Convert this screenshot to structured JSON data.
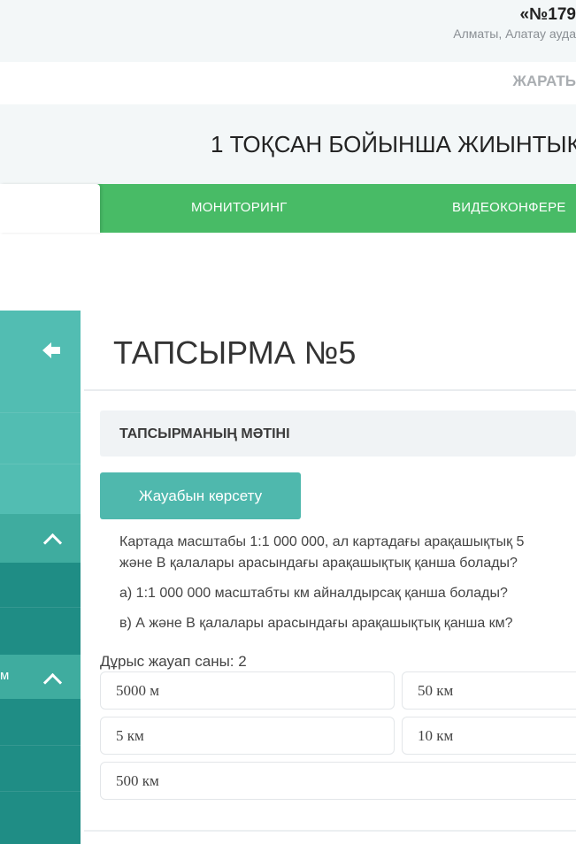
{
  "header": {
    "school_name": "«№179",
    "address": "Алматы, Алатау ауда",
    "strip_text": "ЖАРАТЬ",
    "page_title": "1 ТОҚСАН БОЙЫНША ЖИЫНТЫК"
  },
  "nav": {
    "tabs": [
      {
        "label": ""
      },
      {
        "label": "МОНИТОРИНГ"
      },
      {
        "label": "ВИДЕОКОНФЕРЕ"
      }
    ]
  },
  "sidebar": {
    "item_label": "м"
  },
  "task": {
    "title": "ТАПСЫРМА №5",
    "section_header": "ТАПСЫРМАНЫҢ МӘТІНІ",
    "show_answer_label": "Жауабын көрсету",
    "question_line1": "Картада масштабы 1:1 000 000, ал картадағы арақашықтық 5",
    "question_line2": "және В қалалары арасындағы арақашықтық қанша болады?",
    "sub_a": "а) 1:1 000 000 масштабты км айналдырсақ қанша болады?",
    "sub_b": "в) А және В қалалары арасындағы арақашықтық қанша км?",
    "correct_count": "Дұрыс жауап саны: 2",
    "options": [
      "5000 м",
      "50 км",
      "5 км",
      "10 км",
      "500 км"
    ]
  },
  "colors": {
    "accent_green": "#48bb66",
    "teal_button": "#4fb8ad",
    "sidebar_teal": "#1f8d85"
  }
}
